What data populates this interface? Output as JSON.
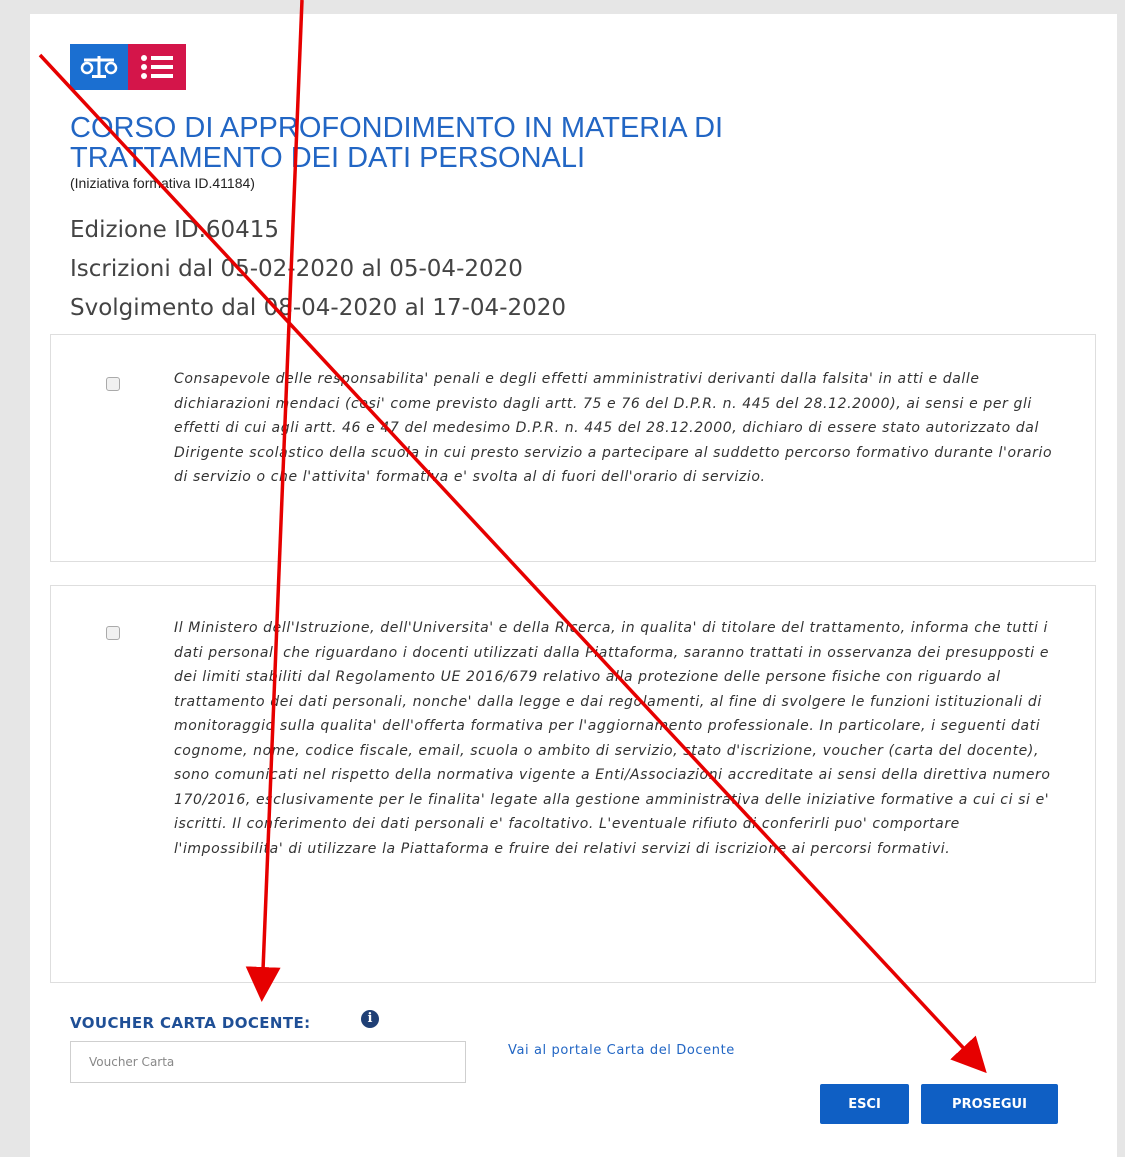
{
  "course": {
    "title": "CORSO DI APPROFONDIMENTO IN MATERIA DI TRATTAMENTO DEI DATI PERSONALI",
    "subtitle": "(Iniziativa formativa ID.41184)",
    "edition": "Edizione ID.60415",
    "enrollment": "Iscrizioni dal 05-02-2020 al 05-04-2020",
    "schedule": "Svolgimento dal 08-04-2020 al 17-04-2020"
  },
  "declarations": [
    {
      "text": "Consapevole delle responsabilita' penali e degli effetti amministrativi derivanti dalla falsita' in atti e dalle dichiarazioni mendaci (cosi' come previsto dagli artt. 75 e 76 del D.P.R. n. 445 del 28.12.2000), ai sensi e per gli effetti di cui agli artt. 46 e 47 del medesimo D.P.R. n. 445 del 28.12.2000, dichiaro di essere stato autorizzato dal Dirigente scolastico della scuola in cui presto servizio a partecipare al suddetto percorso formativo durante l'orario di servizio o che l'attivita' formativa e' svolta al di fuori dell'orario di servizio.",
      "checked": false
    },
    {
      "text": "Il Ministero dell'Istruzione, dell'Universita' e della Ricerca, in qualita' di titolare del trattamento, informa che tutti i dati personali che riguardano i docenti utilizzati dalla Piattaforma, saranno trattati in osservanza dei presupposti e dei limiti stabiliti dal Regolamento UE 2016/679 relativo alla protezione delle persone fisiche con riguardo al trattamento dei dati personali, nonche' dalla legge e dai regolamenti, al fine di svolgere le funzioni istituzionali di monitoraggio sulla qualita' dell'offerta formativa per l'aggiornamento professionale. In particolare, i seguenti dati cognome, nome, codice fiscale, email, scuola o ambito di servizio, stato d'iscrizione, voucher (carta del docente), sono comunicati nel rispetto della normativa vigente a Enti/Associazioni accreditate ai sensi della direttiva numero 170/2016, esclusivamente per le finalita' legate alla gestione amministrativa delle iniziative formative a cui ci si e' iscritti. Il conferimento dei dati personali e' facoltativo. L'eventuale rifiuto di conferirli puo' comportare l'impossibilita' di utilizzare la Piattaforma e fruire dei relativi servizi di iscrizione ai percorsi formativi.",
      "checked": false
    }
  ],
  "voucher": {
    "label": "VOUCHER CARTA DOCENTE:",
    "info_icon": "i",
    "placeholder": "Voucher Carta",
    "value": "",
    "portal_link": "Vai al portale Carta del Docente"
  },
  "buttons": {
    "exit": "ESCI",
    "continue": "PROSEGUI"
  },
  "colors": {
    "title_blue": "#2266c4",
    "logo_blue": "#1b6fd1",
    "logo_red": "#d4154a",
    "button_blue": "#0f5fc4",
    "annotation_red": "#e60000"
  },
  "icons": {
    "logo_left": "scales-icon",
    "logo_right": "list-icon",
    "info": "info-circle-icon"
  }
}
